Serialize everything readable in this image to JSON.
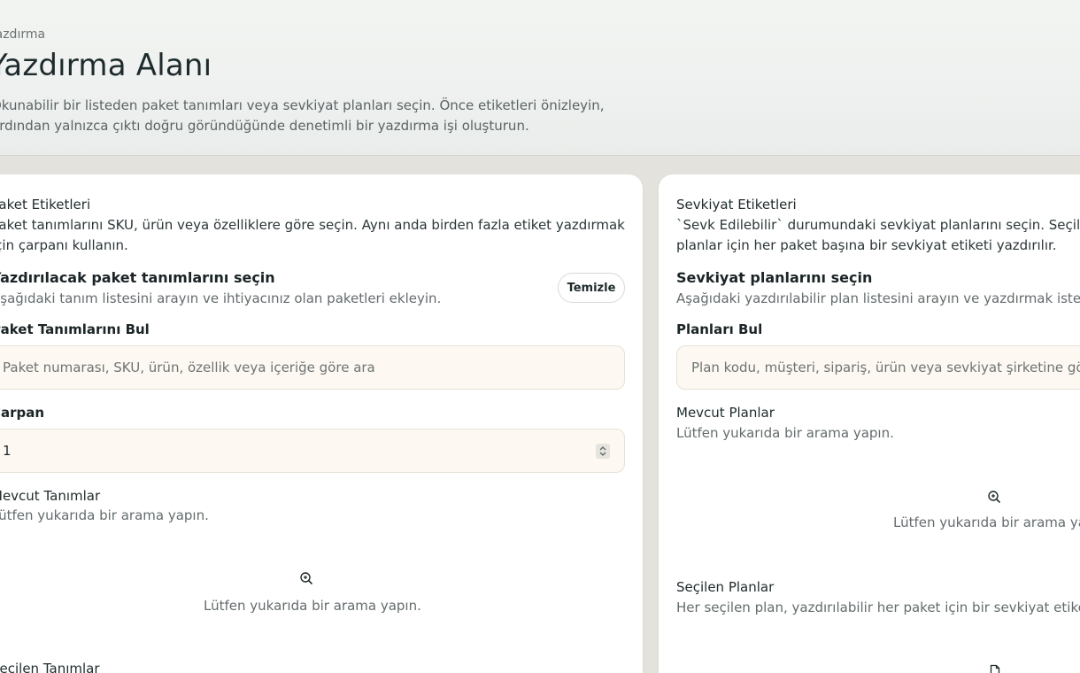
{
  "header": {
    "breadcrumb": "Yazdırma",
    "title": "Yazdırma Alanı",
    "description": "Okunabilir bir listeden paket tanımları veya sevkiyat planları seçin. Önce etiketleri önizleyin, ardından yalnızca çıktı doğru göründüğünde denetimli bir yazdırma işi oluşturun."
  },
  "package_card": {
    "title": "Paket Etiketleri",
    "description": "Paket tanımlarını SKU, ürün veya özelliklere göre seçin. Aynı anda birden fazla etiket yazdırmak için çarpanı kullanın.",
    "section_title": "Yazdırılacak paket tanımlarını seçin",
    "section_subtitle": "Aşağıdaki tanım listesini arayın ve ihtiyacınız olan paketleri ekleyin.",
    "clear_button": "Temizle",
    "search_label": "Paket Tanımlarını Bul",
    "search_placeholder": "Paket numarası, SKU, ürün, özellik veya içeriğe göre ara",
    "multiplier_label": "Çarpan",
    "multiplier_value": "1",
    "available_title": "Mevcut Tanımlar",
    "available_subtitle": "Lütfen yukarıda bir arama yapın.",
    "empty_text": "Lütfen yukarıda bir arama yapın.",
    "selected_title": "Seçilen Tanımlar"
  },
  "shipment_card": {
    "title": "Sevkiyat Etiketleri",
    "description": "`Sevk Edilebilir` durumundaki sevkiyat planlarını seçin. Seçilen planlar için her paket başına bir sevkiyat etiketi yazdırılır.",
    "section_title": "Sevkiyat planlarını seçin",
    "section_subtitle": "Aşağıdaki yazdırılabilir plan listesini arayın ve yazdırmak istediğiniz planları ekleyin.",
    "search_label": "Planları Bul",
    "search_placeholder": "Plan kodu, müşteri, sipariş, ürün veya sevkiyat şirketine göre ara",
    "available_title": "Mevcut Planlar",
    "available_subtitle": "Lütfen yukarıda bir arama yapın.",
    "empty_text": "Lütfen yukarıda bir arama yapın.",
    "selected_title": "Seçilen Planlar",
    "selected_subtitle": "Her seçilen plan, yazdırılabilir her paket için bir sevkiyat etiketine dönüşür."
  },
  "icons": {
    "search_empty": "zoom-search-icon",
    "document": "document-icon",
    "stepper": "chevron-up-down-icon"
  }
}
